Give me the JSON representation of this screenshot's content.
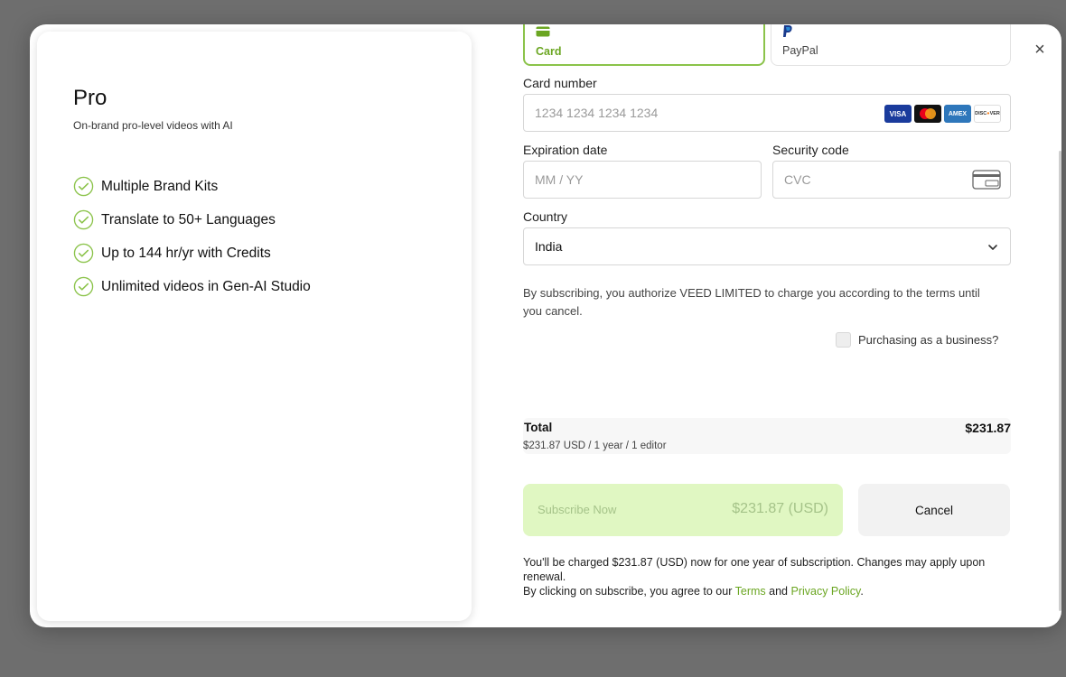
{
  "plan": {
    "title": "Pro",
    "subtitle": "On-brand pro-level videos with AI",
    "features": [
      "Multiple Brand Kits",
      "Translate to 50+ Languages",
      "Up to 144 hr/yr with Credits",
      "Unlimited videos in Gen-AI Studio"
    ]
  },
  "payment_methods": {
    "card_label": "Card",
    "paypal_label": "PayPal",
    "selected": "Card"
  },
  "form": {
    "card_number_label": "Card number",
    "card_number_placeholder": "1234 1234 1234 1234",
    "card_brands": [
      "VISA",
      "Mastercard",
      "AMEX",
      "DISCOVER"
    ],
    "expiration_label": "Expiration date",
    "expiration_placeholder": "MM / YY",
    "security_label": "Security code",
    "security_placeholder": "CVC",
    "country_label": "Country",
    "country_value": "India"
  },
  "legal_text": "By subscribing, you authorize VEED LIMITED to charge you according to the terms until you cancel.",
  "business_checkbox": {
    "label": "Purchasing as a business?",
    "checked": false
  },
  "total": {
    "label": "Total",
    "amount": "$231.87",
    "detail": "$231.87 USD / 1 year / 1 editor"
  },
  "buttons": {
    "subscribe_label": "Subscribe Now",
    "subscribe_price": "$231.87 (USD)",
    "cancel_label": "Cancel"
  },
  "fineprint": {
    "charge_text": "You'll be charged $231.87 (USD) now for one year of subscription. Changes may apply upon renewal.",
    "agree_prefix": "By clicking on subscribe, you agree to our",
    "terms_link": "Terms",
    "and": "and",
    "privacy_link": "Privacy Policy",
    "suffix": "."
  },
  "colors": {
    "accent": "#8bc34a",
    "accent_text": "#6ba622",
    "subscribe_bg": "#e0f7c2",
    "overlay": "#6e6e6e"
  }
}
